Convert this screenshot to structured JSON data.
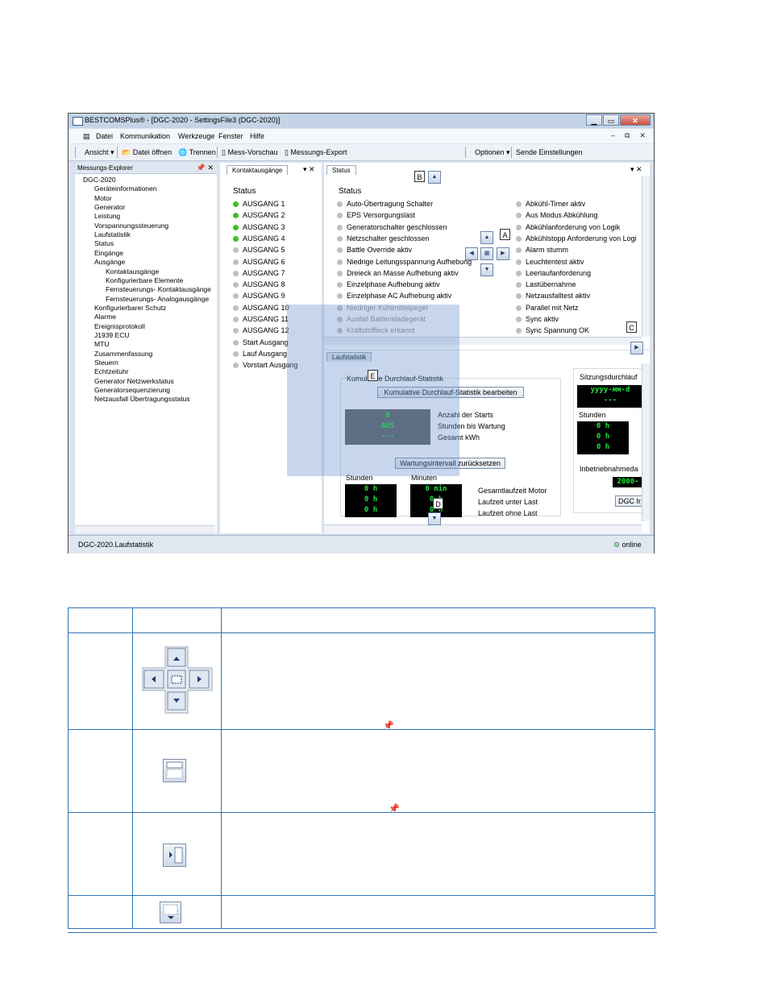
{
  "window": {
    "title": "BESTCOMSPlus® - [DGC-2020 - SettingsFile3 (DGC-2020)]",
    "menu": [
      "Datei",
      "Kommunikation",
      "Werkzeuge",
      "Fenster",
      "Hilfe"
    ],
    "toolbar": {
      "view": "Ansicht",
      "open": "Datei öffnen",
      "disconnect": "Trennen",
      "preview": "Mess-Vorschau",
      "export": "Messungs-Export",
      "options": "Optionen",
      "send": "Sende Einstellungen"
    }
  },
  "explorer": {
    "title": "Messungs-Explorer",
    "items": [
      "DGC-2020",
      "Geräteinformationen",
      "Motor",
      "Generator",
      "Leistung",
      "Vorspannungssteuerung",
      "Laufstatistik",
      "Status",
      "Eingänge",
      "Ausgänge",
      "Kontaktausgänge",
      "Konfigurierbare Elemente",
      "Fernsteuerungs- Kontaktausgänge",
      "Fernsteuerungs- Analogausgänge",
      "Konfigurierbarer Schutz",
      "Alarme",
      "Ereignisprotokoll",
      "J1939 ECU",
      "MTU",
      "Zusammenfassung",
      "Steuern",
      "Echtzeituhr",
      "Generator Netzwerkstatus",
      "Generatorsequenzierung",
      "Netzausfall Übertragungsstatus"
    ]
  },
  "contacts": {
    "tab": "Kontaktausgänge",
    "heading": "Status",
    "outputs": [
      "AUSGANG 1",
      "AUSGANG 2",
      "AUSGANG 3",
      "AUSGANG 4",
      "AUSGANG 5",
      "AUSGANG 6",
      "AUSGANG 7",
      "AUSGANG 8",
      "AUSGANG 9",
      "AUSGANG 10",
      "AUSGANG 11",
      "AUSGANG 12",
      "Start Ausgang",
      "Lauf Ausgang",
      "Vorstart Ausgang"
    ],
    "on": [
      true,
      true,
      true,
      true,
      false,
      false,
      false,
      false,
      false,
      false,
      false,
      false,
      false,
      false,
      false
    ]
  },
  "status": {
    "tab": "Status",
    "heading": "Status",
    "left": [
      "Auto-Übertragung Schalter",
      "EPS Versorgungslast",
      "Generatorschalter geschlossen",
      "Netzschalter geschlossen",
      "Battle Override aktiv",
      "Niedrige Leitungsspannung Aufhebung",
      "Dreieck an Masse Aufhebung aktiv",
      "Einzelphase Aufhebung aktiv",
      "Einzelphase AC Aufhebung aktiv",
      "Niedriger Kühlmittelpegel",
      "Ausfall Batterieladegerät",
      "Kraftstoffleck erkannt"
    ],
    "right": [
      "Abkühl-Timer aktiv",
      "Aus Modus Abkühlung",
      "Abkühlanforderung von Logik",
      "Abkühlstopp Anforderung von Logi",
      "Alarm stumm",
      "Leuchtentest aktiv",
      "Leerlaufanforderung",
      "Lastübernahme",
      "Netzausfalltest aktiv",
      "Parallel mit Netz",
      "Sync aktiv",
      "Sync Spannung OK"
    ]
  },
  "runstats": {
    "tab": "Laufstatistik",
    "group": "Kumulative Durchlauf-Statistik",
    "edit_button": "Kumulative Durchlauf-Statistik bearbeiten",
    "lcd1": [
      "0",
      "AUS",
      "---"
    ],
    "labels1": [
      "Anzahl der Starts",
      "Stunden bis Wartung",
      "Gesamt kWh"
    ],
    "reset_button": "Wartungsintervall zurücksetzen",
    "hours_label": "Stunden",
    "minutes_label": "Minuten",
    "hours": [
      "0 h",
      "0 h",
      "0 h"
    ],
    "minutes": [
      "0 min",
      "0 h",
      "0 h"
    ],
    "labels2": [
      "Gesamtlaufzeit Motor",
      "Laufzeit unter Last",
      "Laufzeit ohne Last"
    ],
    "session_label": "Sitzungsdurchlauf",
    "session_lcd": [
      "yyyy-мм-d",
      "---"
    ],
    "session_hours_label": "Stunden",
    "session_hours": [
      "0 h",
      "0 h",
      "0 h"
    ],
    "commission_label": "Inbetriebnahmeda",
    "commission_lcd": "2000-",
    "dgc_button": "DGC Ir"
  },
  "statusbar": {
    "left": "DGC-2020.Laufstatistik",
    "right": "online"
  },
  "callouts": [
    "A",
    "B",
    "C",
    "D",
    "E"
  ]
}
